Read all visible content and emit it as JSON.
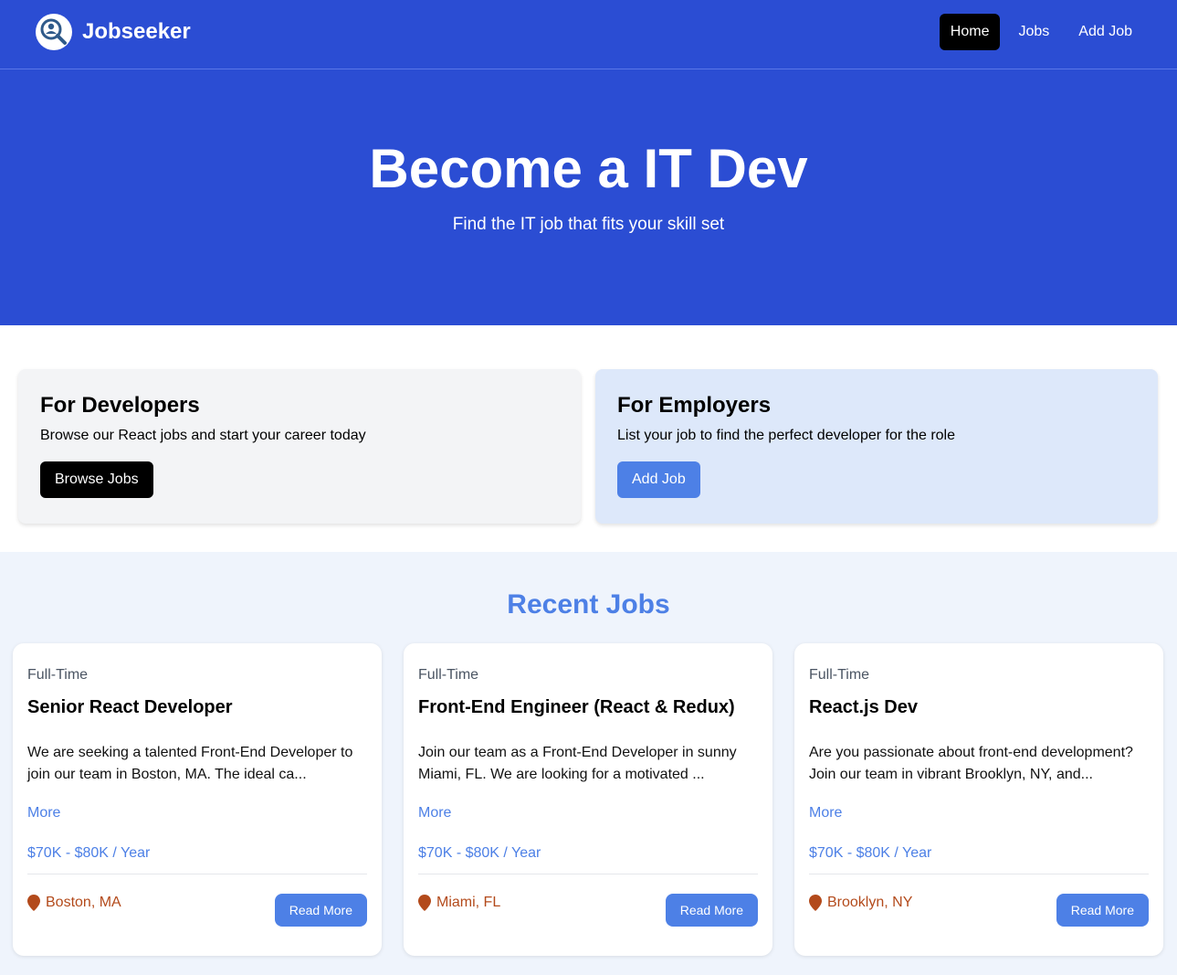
{
  "brand": {
    "name": "Jobseeker"
  },
  "nav": {
    "items": [
      "Home",
      "Jobs",
      "Add Job"
    ],
    "active": "Home"
  },
  "hero": {
    "title": "Become a IT Dev",
    "subtitle": "Find the IT job that fits your skill set"
  },
  "cards": [
    {
      "heading": "For Developers",
      "text": "Browse our React jobs and start your career today",
      "button": "Browse Jobs"
    },
    {
      "heading": "For Employers",
      "text": "List your job to find the perfect developer for the role",
      "button": "Add Job"
    }
  ],
  "recent_jobs": {
    "heading": "Recent Jobs",
    "jobs": [
      {
        "type": "Full-Time",
        "title": "Senior React Developer",
        "description": "We are seeking a talented Front-End Developer to join our team in Boston, MA. The ideal ca...",
        "more": "More",
        "salary": "$70K - $80K / Year",
        "location": "Boston, MA",
        "button": "Read More"
      },
      {
        "type": "Full-Time",
        "title": "Front-End Engineer (React & Redux)",
        "description": "Join our team as a Front-End Developer in sunny Miami, FL. We are looking for a motivated ...",
        "more": "More",
        "salary": "$70K - $80K / Year",
        "location": "Miami, FL",
        "button": "Read More"
      },
      {
        "type": "Full-Time",
        "title": "React.js Dev",
        "description": "Are you passionate about front-end development? Join our team in vibrant Brooklyn, NY, and...",
        "more": "More",
        "salary": "$70K - $80K / Year",
        "location": "Brooklyn, NY",
        "button": "Read More"
      }
    ]
  },
  "colors": {
    "primary": "#2b4dd3",
    "accent": "#4d80e6",
    "location": "#b34a1b",
    "employer_card": "#dde8fa",
    "developer_card": "#f3f4f6",
    "jobs_bg": "#eff4fc"
  },
  "icons": {
    "logo": "search-person-icon",
    "location": "map-pin-icon"
  }
}
